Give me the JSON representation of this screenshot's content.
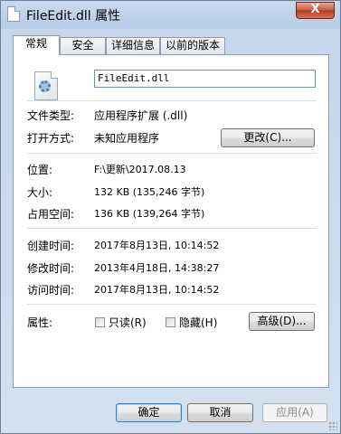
{
  "window": {
    "title": "FileEdit.dll 属性",
    "close_label": "X"
  },
  "tabs": [
    "常规",
    "安全",
    "详细信息",
    "以前的版本"
  ],
  "general": {
    "file_name": "FileEdit.dll",
    "file_type_label": "文件类型:",
    "file_type_value": "应用程序扩展 (.dll)",
    "open_with_label": "打开方式:",
    "open_with_value": "未知应用程序",
    "change_button": "更改(C)...",
    "location_label": "位置:",
    "location_value": "F:\\更新\\2017.08.13",
    "size_label": "大小:",
    "size_value": "132 KB (135,246 字节)",
    "size_on_disk_label": "占用空间:",
    "size_on_disk_value": "136 KB (139,264 字节)",
    "created_label": "创建时间:",
    "created_value": "2017年8月13日, 10:14:52",
    "modified_label": "修改时间:",
    "modified_value": "2013年4月18日, 14:38:27",
    "accessed_label": "访问时间:",
    "accessed_value": "2017年8月13日, 10:14:52",
    "attributes_label": "属性:",
    "readonly_label": "只读(R)",
    "hidden_label": "隐藏(H)",
    "advanced_button": "高级(D)..."
  },
  "footer": {
    "ok": "确定",
    "cancel": "取消",
    "apply": "应用(A)"
  }
}
